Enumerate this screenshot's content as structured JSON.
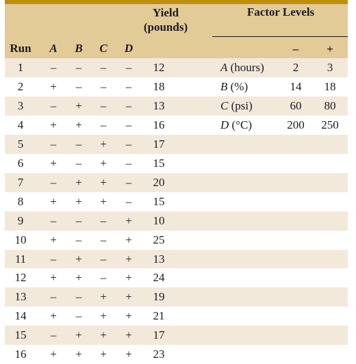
{
  "figure": {
    "headers": {
      "yield_line1": "Yield",
      "yield_line2": "(pounds)",
      "factor_levels": "Factor Levels",
      "level_low": "–",
      "level_high": "+",
      "run": "Run",
      "factor_a": "A",
      "factor_b": "B",
      "factor_c": "C",
      "factor_d": "D"
    },
    "colors": {
      "top_rule": "#bf8f0c",
      "header_band": "#e3cb97",
      "stripe_row": "#f3e9db",
      "plain_row": "#ffffff",
      "text": "#1a1a24"
    },
    "runs": [
      {
        "run": "1",
        "a": "–",
        "b": "–",
        "c": "–",
        "d": "–",
        "yield": "12"
      },
      {
        "run": "2",
        "a": "+",
        "b": "–",
        "c": "–",
        "d": "–",
        "yield": "18"
      },
      {
        "run": "3",
        "a": "–",
        "b": "+",
        "c": "–",
        "d": "–",
        "yield": "13"
      },
      {
        "run": "4",
        "a": "+",
        "b": "+",
        "c": "–",
        "d": "–",
        "yield": "16"
      },
      {
        "run": "5",
        "a": "–",
        "b": "–",
        "c": "+",
        "d": "–",
        "yield": "17"
      },
      {
        "run": "6",
        "a": "+",
        "b": "–",
        "c": "+",
        "d": "–",
        "yield": "15"
      },
      {
        "run": "7",
        "a": "–",
        "b": "+",
        "c": "+",
        "d": "–",
        "yield": "20"
      },
      {
        "run": "8",
        "a": "+",
        "b": "+",
        "c": "+",
        "d": "–",
        "yield": "15"
      },
      {
        "run": "9",
        "a": "–",
        "b": "–",
        "c": "–",
        "d": "+",
        "yield": "10"
      },
      {
        "run": "10",
        "a": "+",
        "b": "–",
        "c": "–",
        "d": "+",
        "yield": "25"
      },
      {
        "run": "11",
        "a": "–",
        "b": "+",
        "c": "–",
        "d": "+",
        "yield": "13"
      },
      {
        "run": "12",
        "a": "+",
        "b": "+",
        "c": "–",
        "d": "+",
        "yield": "24"
      },
      {
        "run": "13",
        "a": "–",
        "b": "–",
        "c": "+",
        "d": "+",
        "yield": "19"
      },
      {
        "run": "14",
        "a": "+",
        "b": "–",
        "c": "+",
        "d": "+",
        "yield": "21"
      },
      {
        "run": "15",
        "a": "–",
        "b": "+",
        "c": "+",
        "d": "+",
        "yield": "17"
      },
      {
        "run": "16",
        "a": "+",
        "b": "+",
        "c": "+",
        "d": "+",
        "yield": "23"
      }
    ],
    "factor_levels": [
      {
        "symbol": "A",
        "unit": "(hours)",
        "low": "2",
        "high": "3"
      },
      {
        "symbol": "B",
        "unit": "(%)",
        "low": "14",
        "high": "18"
      },
      {
        "symbol": "C",
        "unit": "(psi)",
        "low": "60",
        "high": "80"
      },
      {
        "symbol": "D",
        "unit": "(°C)",
        "low": "200",
        "high": "250"
      }
    ]
  },
  "chart_data": {
    "type": "table",
    "title": "Factorial design: Yield (pounds) by factor level combination",
    "columns": [
      "Run",
      "A",
      "B",
      "C",
      "D",
      "Yield (pounds)"
    ],
    "rows": [
      [
        "1",
        "-",
        "-",
        "-",
        "-",
        12
      ],
      [
        "2",
        "+",
        "-",
        "-",
        "-",
        18
      ],
      [
        "3",
        "-",
        "+",
        "-",
        "-",
        13
      ],
      [
        "4",
        "+",
        "+",
        "-",
        "-",
        16
      ],
      [
        "5",
        "-",
        "-",
        "+",
        "-",
        17
      ],
      [
        "6",
        "+",
        "-",
        "+",
        "-",
        15
      ],
      [
        "7",
        "-",
        "+",
        "+",
        "-",
        20
      ],
      [
        "8",
        "+",
        "+",
        "+",
        "-",
        15
      ],
      [
        "9",
        "-",
        "-",
        "-",
        "+",
        10
      ],
      [
        "10",
        "+",
        "-",
        "-",
        "+",
        25
      ],
      [
        "11",
        "-",
        "+",
        "-",
        "+",
        13
      ],
      [
        "12",
        "+",
        "+",
        "-",
        "+",
        24
      ],
      [
        "13",
        "-",
        "-",
        "+",
        "+",
        19
      ],
      [
        "14",
        "+",
        "-",
        "+",
        "+",
        21
      ],
      [
        "15",
        "-",
        "+",
        "+",
        "+",
        17
      ],
      [
        "16",
        "+",
        "+",
        "+",
        "+",
        23
      ]
    ],
    "factor_levels_table": {
      "columns": [
        "Factor",
        "-",
        "+"
      ],
      "rows": [
        [
          "A (hours)",
          2,
          3
        ],
        [
          "B (%)",
          14,
          18
        ],
        [
          "C (psi)",
          60,
          80
        ],
        [
          "D (°C)",
          200,
          250
        ]
      ]
    }
  }
}
